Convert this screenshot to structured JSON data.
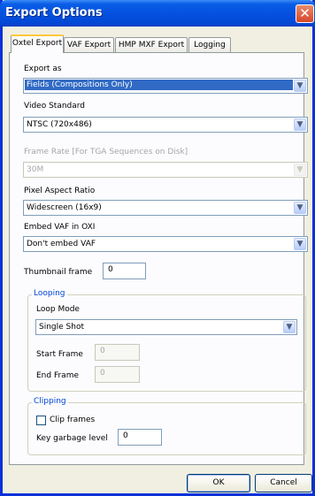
{
  "window": {
    "title": "Export Options"
  },
  "tabs": [
    {
      "label": "Oxtel Export",
      "active": true
    },
    {
      "label": "VAF Export",
      "active": false
    },
    {
      "label": "HMP MXF Export",
      "active": false
    },
    {
      "label": "Logging",
      "active": false
    }
  ],
  "fields": {
    "export_as": {
      "label": "Export as",
      "value": "Fields (Compositions Only)"
    },
    "video_standard": {
      "label": "Video Standard",
      "value": "NTSC (720x486)"
    },
    "frame_rate": {
      "label": "Frame Rate [For TGA Sequences on Disk]",
      "value": "30M",
      "enabled": false
    },
    "pixel_aspect": {
      "label": "Pixel Aspect Ratio",
      "value": "Widescreen (16x9)"
    },
    "embed_vaf": {
      "label": "Embed VAF in OXI",
      "value": "Don't embed VAF"
    },
    "thumbnail": {
      "label": "Thumbnail frame",
      "value": "0"
    }
  },
  "looping": {
    "title": "Looping",
    "mode_label": "Loop Mode",
    "mode_value": "Single Shot",
    "start_label": "Start Frame",
    "start_value": "0",
    "end_label": "End Frame",
    "end_value": "0"
  },
  "clipping": {
    "title": "Clipping",
    "clip_label": "Clip frames",
    "clip_checked": false,
    "key_label": "Key garbage level",
    "key_value": "0"
  },
  "buttons": {
    "ok": "OK",
    "cancel": "Cancel"
  },
  "icons": {
    "close": "close-icon",
    "dropdown": "chevron-down-icon"
  },
  "colors": {
    "titlebar": "#0551e0",
    "selection": "#316ac5",
    "group_title": "#0046d5",
    "close": "#d6462a"
  }
}
